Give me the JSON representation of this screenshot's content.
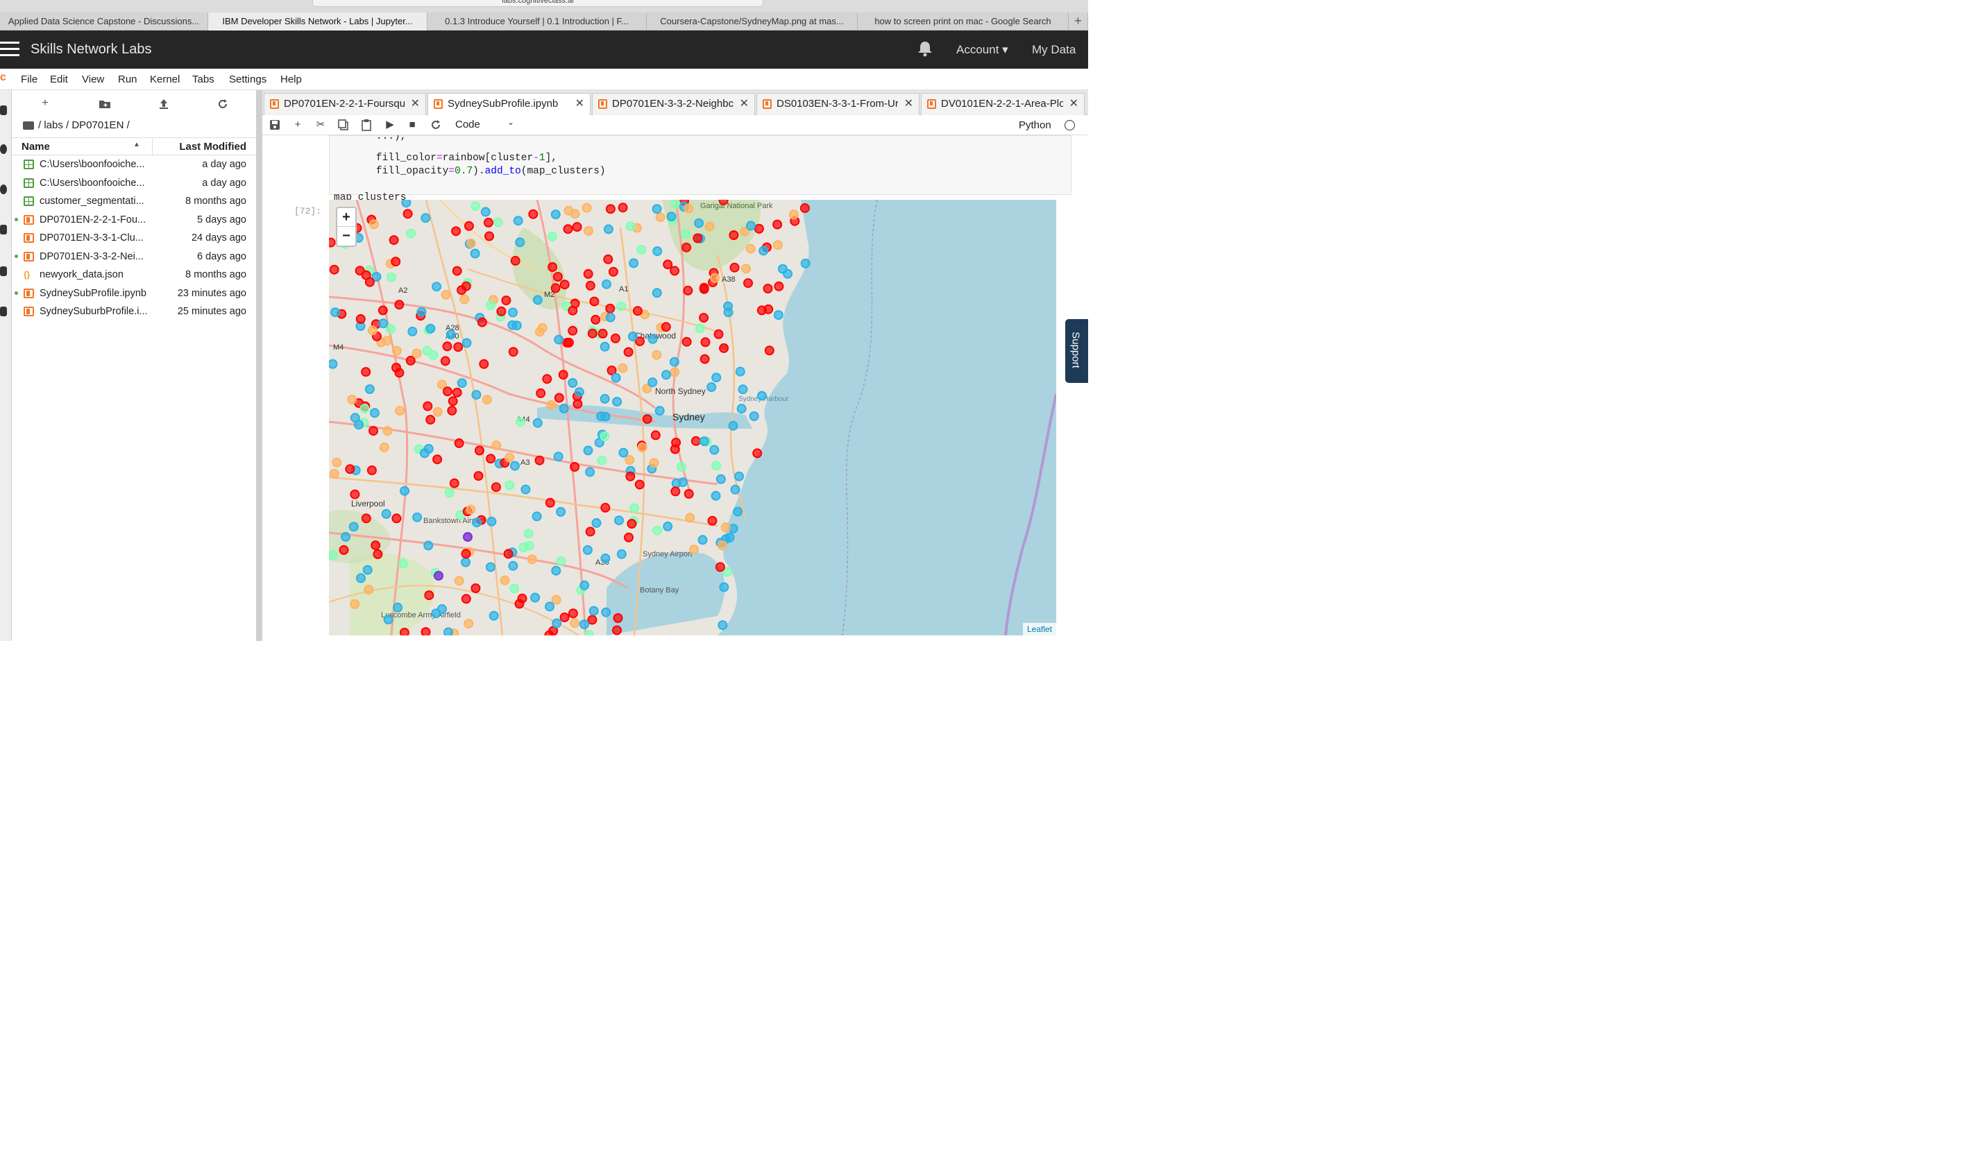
{
  "browser": {
    "url": "labs.cognitiveclass.ai",
    "tabs": [
      {
        "label": "Applied Data Science Capstone - Discussions...",
        "active": false
      },
      {
        "label": "IBM Developer Skills Network - Labs | Jupyter...",
        "active": true
      },
      {
        "label": "0.1.3 Introduce Yourself | 0.1 Introduction | F...",
        "active": false
      },
      {
        "label": "Coursera-Capstone/SydneyMap.png at mas...",
        "active": false
      },
      {
        "label": "how to screen print on mac - Google Search",
        "active": false
      }
    ],
    "new_tab": "+"
  },
  "header": {
    "brand": "Skills Network Labs",
    "account": "Account ▾",
    "my_data": "My Data"
  },
  "menu": [
    "File",
    "Edit",
    "View",
    "Run",
    "Kernel",
    "Tabs",
    "Settings",
    "Help"
  ],
  "file_browser": {
    "breadcrumb": "/ labs / DP0701EN /",
    "col_name": "Name",
    "col_modified": "Last Modified",
    "files": [
      {
        "name": "C:\\Users\\boonfooiche...",
        "modified": "a day ago",
        "type": "csv",
        "running": false
      },
      {
        "name": "C:\\Users\\boonfooiche...",
        "modified": "a day ago",
        "type": "csv",
        "running": false
      },
      {
        "name": "customer_segmentati...",
        "modified": "8 months ago",
        "type": "csv",
        "running": false
      },
      {
        "name": "DP0701EN-2-2-1-Fou...",
        "modified": "5 days ago",
        "type": "notebook",
        "running": true
      },
      {
        "name": "DP0701EN-3-3-1-Clu...",
        "modified": "24 days ago",
        "type": "notebook",
        "running": false
      },
      {
        "name": "DP0701EN-3-3-2-Nei...",
        "modified": "6 days ago",
        "type": "notebook",
        "running": true
      },
      {
        "name": "newyork_data.json",
        "modified": "8 months ago",
        "type": "json",
        "running": false
      },
      {
        "name": "SydneySubProfile.ipynb",
        "modified": "23 minutes ago",
        "type": "notebook",
        "running": true
      },
      {
        "name": "SydneySuburbProfile.i...",
        "modified": "25 minutes ago",
        "type": "notebook",
        "running": false
      }
    ]
  },
  "notebook_tabs": [
    {
      "label": "DP0701EN-2-2-1-Foursqu",
      "active": false
    },
    {
      "label": "SydneySubProfile.ipynb",
      "active": true
    },
    {
      "label": "DP0701EN-3-3-2-Neighbc",
      "active": false
    },
    {
      "label": "DS0103EN-3-3-1-From-Ur",
      "active": false
    },
    {
      "label": "DV0101EN-2-2-1-Area-Plo",
      "active": false
    }
  ],
  "toolbar": {
    "cell_type": "Code",
    "kernel": "Python"
  },
  "code": {
    "line1_indent": "       ",
    "line2_indent": "       ",
    "last_line": "map_clusters"
  },
  "output": {
    "prompt": "[72]:",
    "zoom_in": "+",
    "zoom_out": "−",
    "attribution": "Leaflet",
    "place_labels": [
      {
        "text": "Garigal National Park"
      },
      {
        "text": "Chatswood"
      },
      {
        "text": "North Sydney"
      },
      {
        "text": "Sydney"
      },
      {
        "text": "Sydney Harbour"
      },
      {
        "text": "Liverpool"
      },
      {
        "text": "Bankstown Airport"
      },
      {
        "text": "Sydney Airport"
      },
      {
        "text": "Botany Bay"
      },
      {
        "text": "Luscombe Army Airfield"
      },
      {
        "text": "A2"
      },
      {
        "text": "M2"
      },
      {
        "text": "A1"
      },
      {
        "text": "A28"
      },
      {
        "text": "A40"
      },
      {
        "text": "M4"
      },
      {
        "text": "A44"
      },
      {
        "text": "A3"
      },
      {
        "text": "A36"
      },
      {
        "text": "A8"
      },
      {
        "text": "A38"
      }
    ],
    "marker_colors": {
      "cluster_red": "#ff0000",
      "cluster_blue": "#2ab2e6",
      "cluster_orange": "#ffb360",
      "cluster_green": "#80ffb4",
      "cluster_purple": "#7a2fd8"
    }
  },
  "support": "Support"
}
